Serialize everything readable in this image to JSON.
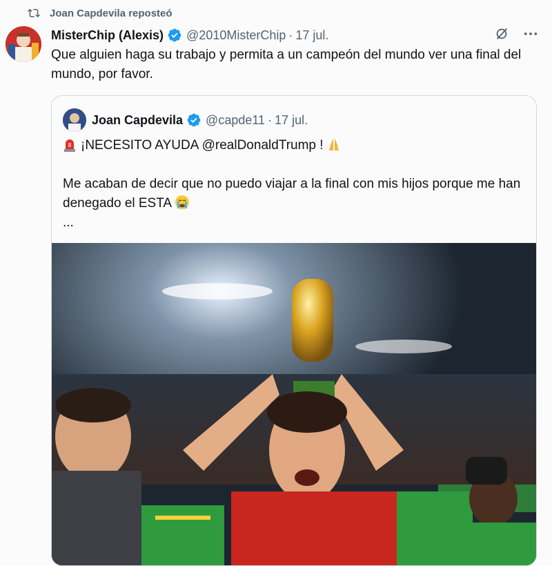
{
  "repost": {
    "label": "Joan Capdevila reposteó"
  },
  "tweet": {
    "author_name": "MisterChip (Alexis)",
    "handle": "@2010MisterChip",
    "separator": "·",
    "date": "17 jul.",
    "text": "Que alguien haga su trabajo y permita a un campeón del mundo ver una final del mundo, por favor."
  },
  "quote": {
    "author_name": "Joan Capdevila",
    "handle": "@capde11",
    "separator": "·",
    "date": "17 jul.",
    "line1": "¡NECESITO AYUDA @realDonaldTrump !",
    "line2": "Me acaban de decir que no puedo viajar a la final con mis hijos porque me han denegado el ESTA",
    "line3": "..."
  },
  "icons": {
    "repost": "repost-icon",
    "verified": "verified-badge-icon",
    "grok": "grok-icon",
    "more": "more-icon",
    "siren": "siren-emoji",
    "pray": "pray-emoji",
    "cry": "crying-emoji"
  },
  "colors": {
    "verified": "#1d9bf0",
    "secondary_text": "#536471"
  }
}
